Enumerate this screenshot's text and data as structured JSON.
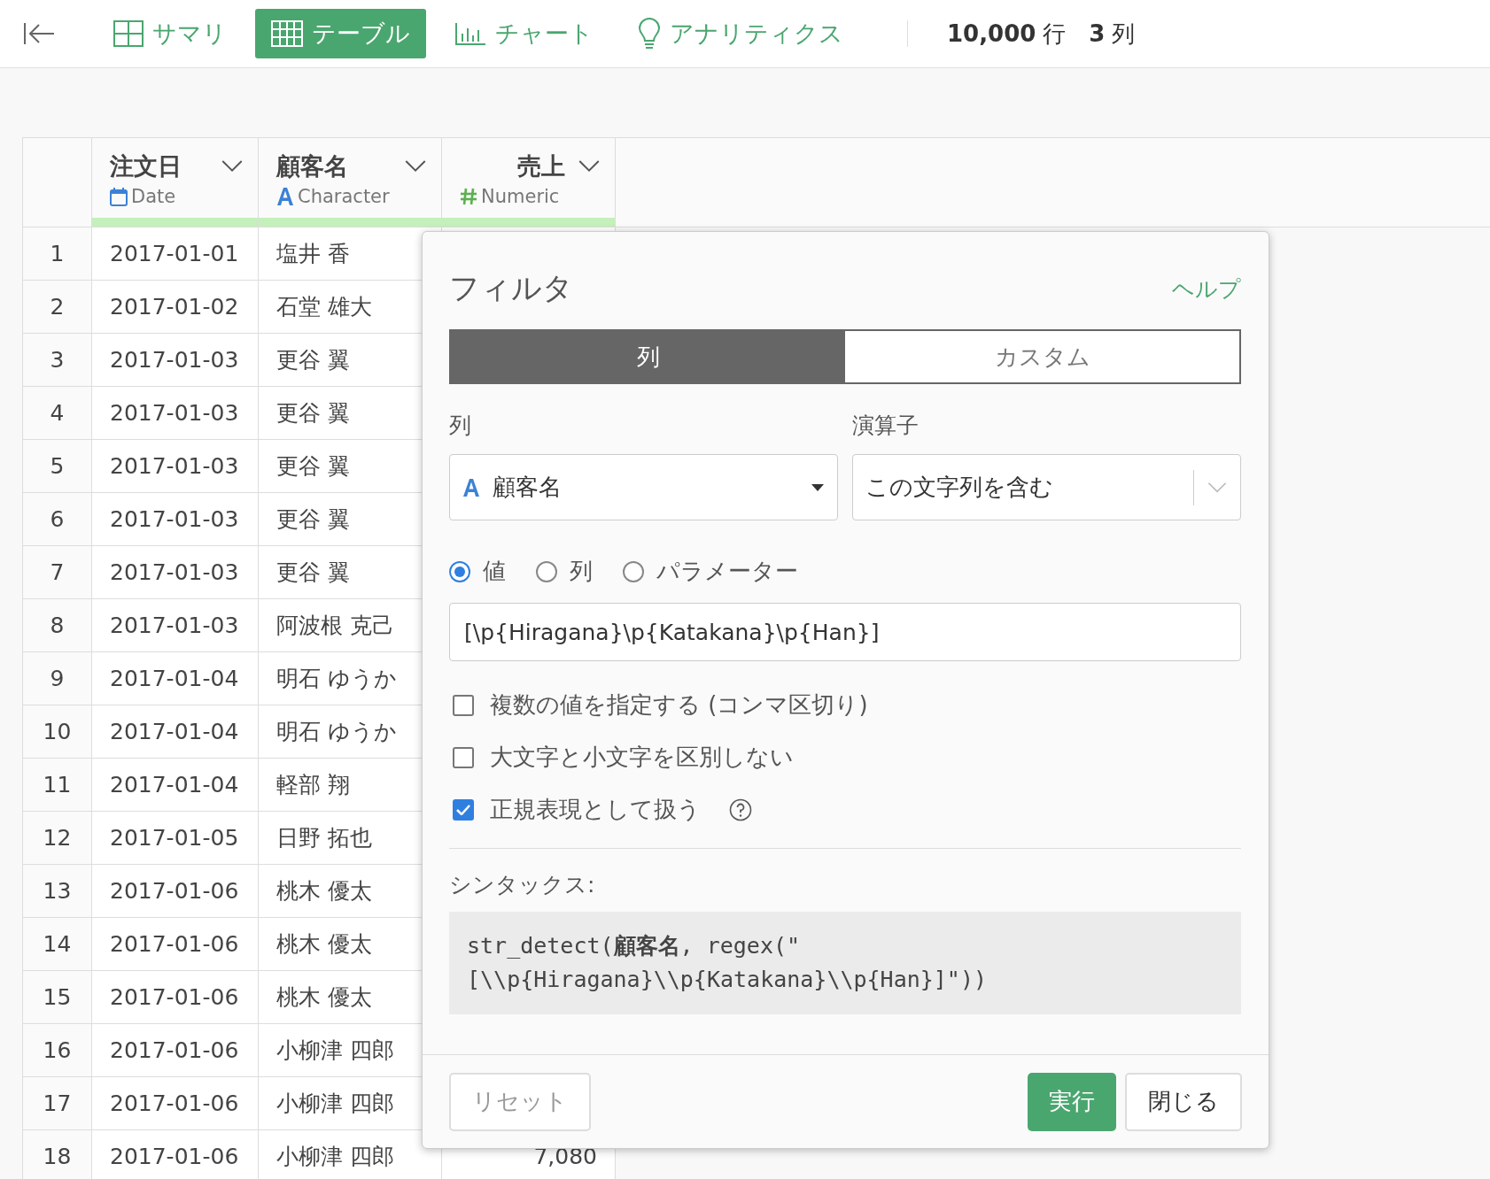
{
  "toolbar": {
    "tabs": [
      {
        "label": "サマリ",
        "kind": "summary",
        "selected": false
      },
      {
        "label": "テーブル",
        "kind": "table",
        "selected": true
      },
      {
        "label": "チャート",
        "kind": "chart",
        "selected": false
      },
      {
        "label": "アナリティクス",
        "kind": "analytics",
        "selected": false
      }
    ],
    "row_count": "10,000",
    "row_unit": "行",
    "col_count": "3",
    "col_unit": "列"
  },
  "table": {
    "columns": [
      {
        "name": "注文日",
        "type": "Date",
        "kind": "date"
      },
      {
        "name": "顧客名",
        "type": "Character",
        "kind": "character"
      },
      {
        "name": "売上",
        "type": "Numeric",
        "kind": "numeric"
      }
    ],
    "rows": [
      {
        "n": "1",
        "date": "2017-01-01",
        "name": "塩井 香"
      },
      {
        "n": "2",
        "date": "2017-01-02",
        "name": "石堂 雄大"
      },
      {
        "n": "3",
        "date": "2017-01-03",
        "name": "更谷 翼"
      },
      {
        "n": "4",
        "date": "2017-01-03",
        "name": "更谷 翼"
      },
      {
        "n": "5",
        "date": "2017-01-03",
        "name": "更谷 翼"
      },
      {
        "n": "6",
        "date": "2017-01-03",
        "name": "更谷 翼"
      },
      {
        "n": "7",
        "date": "2017-01-03",
        "name": "更谷 翼"
      },
      {
        "n": "8",
        "date": "2017-01-03",
        "name": "阿波根 克己"
      },
      {
        "n": "9",
        "date": "2017-01-04",
        "name": "明石 ゆうか"
      },
      {
        "n": "10",
        "date": "2017-01-04",
        "name": "明石 ゆうか"
      },
      {
        "n": "11",
        "date": "2017-01-04",
        "name": "軽部 翔"
      },
      {
        "n": "12",
        "date": "2017-01-05",
        "name": "日野 拓也"
      },
      {
        "n": "13",
        "date": "2017-01-06",
        "name": "桃木 優太"
      },
      {
        "n": "14",
        "date": "2017-01-06",
        "name": "桃木 優太"
      },
      {
        "n": "15",
        "date": "2017-01-06",
        "name": "桃木 優太"
      },
      {
        "n": "16",
        "date": "2017-01-06",
        "name": "小柳津 四郎"
      },
      {
        "n": "17",
        "date": "2017-01-06",
        "name": "小柳津 四郎"
      },
      {
        "n": "18",
        "date": "2017-01-06",
        "name": "小柳津 四郎",
        "sales": "7,080"
      }
    ]
  },
  "dialog": {
    "title": "フィルタ",
    "help": "ヘルプ",
    "tabs": [
      {
        "label": "列",
        "selected": true
      },
      {
        "label": "カスタム",
        "selected": false
      }
    ],
    "column_label": "列",
    "column_value": "顧客名",
    "operator_label": "演算子",
    "operator_value": "この文字列を含む",
    "radios": [
      {
        "label": "値",
        "selected": true
      },
      {
        "label": "列",
        "selected": false
      },
      {
        "label": "パラメーター",
        "selected": false
      }
    ],
    "value": "[\\p{Hiragana}\\p{Katakana}\\p{Han}]",
    "checkboxes": [
      {
        "label": "複数の値を指定する (コンマ区切り)",
        "checked": false,
        "help": false
      },
      {
        "label": "大文字と小文字を区別しない",
        "checked": false,
        "help": false
      },
      {
        "label": "正規表現として扱う",
        "checked": true,
        "help": true
      }
    ],
    "syntax_label": "シンタックス:",
    "syntax_lines": [
      "str_detect(**顧客名**, regex(\"",
      "[\\\\p{Hiragana}\\\\p{Katakana}\\\\p{Han}]\"))"
    ],
    "buttons": {
      "reset": "リセット",
      "run": "実行",
      "close": "閉じる"
    }
  }
}
